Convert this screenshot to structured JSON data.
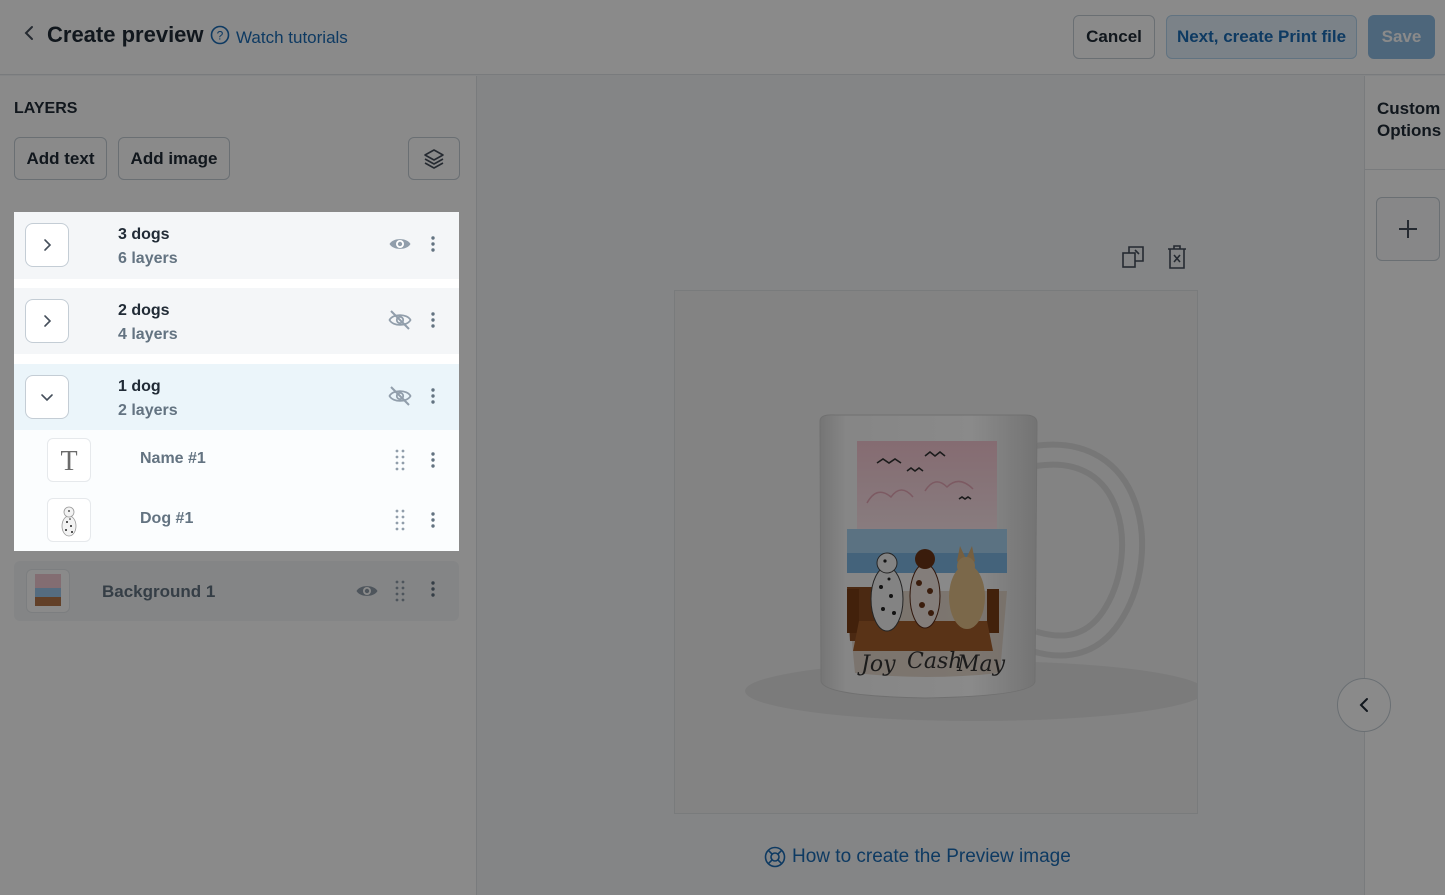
{
  "header": {
    "title": "Create preview",
    "tutorial_link": "Watch tutorials",
    "cancel_label": "Cancel",
    "next_label": "Next, create Print file",
    "save_label": "Save"
  },
  "layers_panel": {
    "title": "LAYERS",
    "add_text_label": "Add text",
    "add_image_label": "Add image",
    "groups": [
      {
        "name": "3 dogs",
        "count": "6 layers",
        "visible": true,
        "expanded": false
      },
      {
        "name": "2 dogs",
        "count": "4 layers",
        "visible": false,
        "expanded": false
      },
      {
        "name": "1 dog",
        "count": "2 layers",
        "visible": false,
        "expanded": true,
        "children": [
          {
            "name": "Name #1",
            "kind": "text"
          },
          {
            "name": "Dog #1",
            "kind": "image"
          }
        ]
      }
    ],
    "background": {
      "name": "Background 1",
      "visible": true
    }
  },
  "canvas": {
    "mug_names": [
      "Joy",
      "Cash",
      "May"
    ],
    "help_link": "How to create the Preview image"
  },
  "custom_options": {
    "title": "Custom Options"
  },
  "colors": {
    "link": "#1a6bb5",
    "overlay": "rgba(0,0,0,0.46)",
    "highlight_bg": "#ebf5fa"
  }
}
